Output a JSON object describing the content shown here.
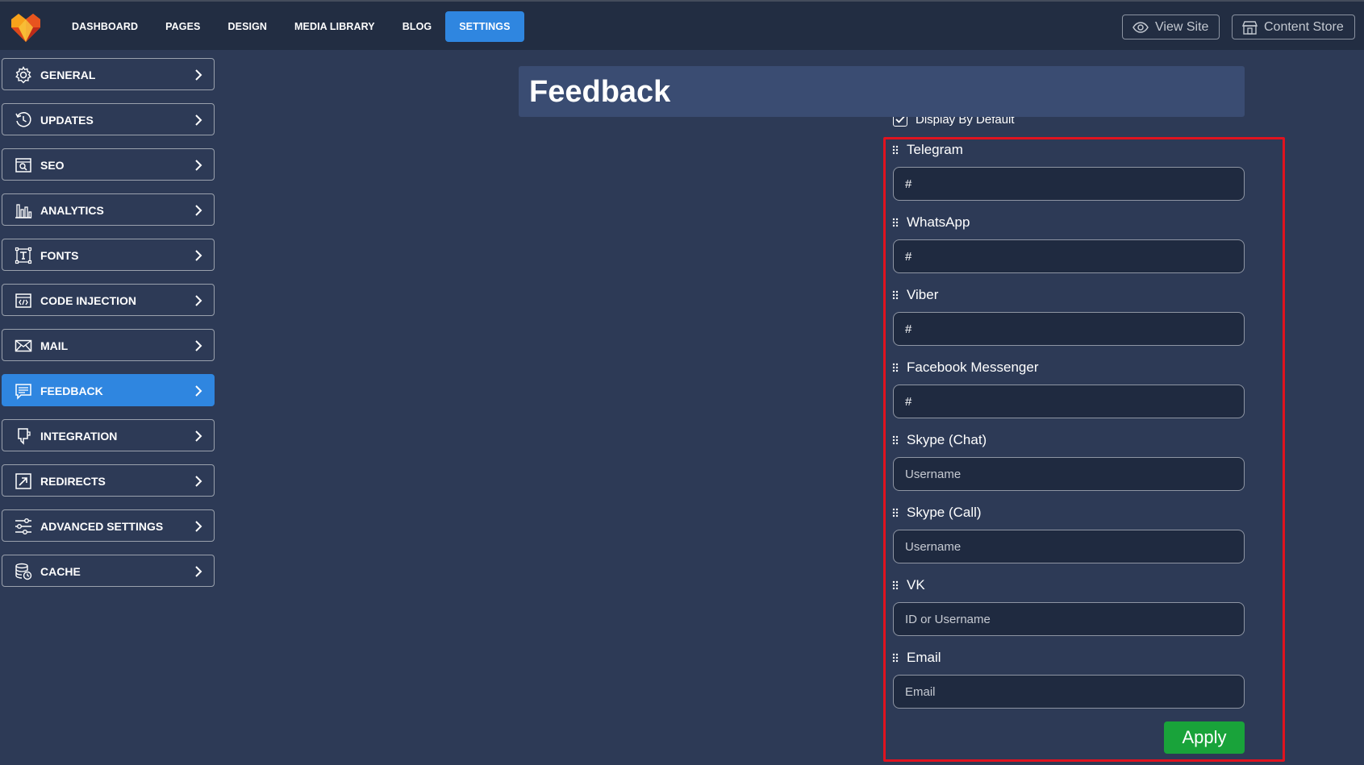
{
  "colors": {
    "background": "#2d3a56",
    "topbar": "#222d42",
    "accent": "#2f86e0",
    "title_bar": "#3a4c72",
    "highlight_border": "#e0131f",
    "apply_green": "#19a33a"
  },
  "nav": {
    "items": [
      {
        "label": "DASHBOARD"
      },
      {
        "label": "PAGES"
      },
      {
        "label": "DESIGN"
      },
      {
        "label": "MEDIA LIBRARY"
      },
      {
        "label": "BLOG"
      },
      {
        "label": "SETTINGS",
        "active": true
      }
    ],
    "view_site": "View Site",
    "content_store": "Content Store"
  },
  "sidebar": {
    "items": [
      {
        "label": "GENERAL",
        "icon": "gear-icon"
      },
      {
        "label": "UPDATES",
        "icon": "history-icon"
      },
      {
        "label": "SEO",
        "icon": "seo-icon"
      },
      {
        "label": "ANALYTICS",
        "icon": "bar-chart-icon"
      },
      {
        "label": "FONTS",
        "icon": "font-icon"
      },
      {
        "label": "CODE INJECTION",
        "icon": "code-icon"
      },
      {
        "label": "MAIL",
        "icon": "mail-icon"
      },
      {
        "label": "FEEDBACK",
        "icon": "feedback-icon",
        "active": true
      },
      {
        "label": "INTEGRATION",
        "icon": "integration-icon"
      },
      {
        "label": "REDIRECTS",
        "icon": "redirect-icon"
      },
      {
        "label": "ADVANCED SETTINGS",
        "icon": "sliders-icon"
      },
      {
        "label": "CACHE",
        "icon": "cache-icon"
      }
    ]
  },
  "main": {
    "title": "Feedback",
    "display_default_label": "Display By Default",
    "display_default_checked": true,
    "fields": [
      {
        "label": "Telegram",
        "value": "#",
        "placeholder": ""
      },
      {
        "label": "WhatsApp",
        "value": "#",
        "placeholder": ""
      },
      {
        "label": "Viber",
        "value": "#",
        "placeholder": ""
      },
      {
        "label": "Facebook Messenger",
        "value": "#",
        "placeholder": ""
      },
      {
        "label": "Skype (Chat)",
        "value": "",
        "placeholder": "Username"
      },
      {
        "label": "Skype (Call)",
        "value": "",
        "placeholder": "Username"
      },
      {
        "label": "VK",
        "value": "",
        "placeholder": "ID or Username"
      },
      {
        "label": "Email",
        "value": "",
        "placeholder": "Email"
      }
    ],
    "apply_label": "Apply"
  }
}
